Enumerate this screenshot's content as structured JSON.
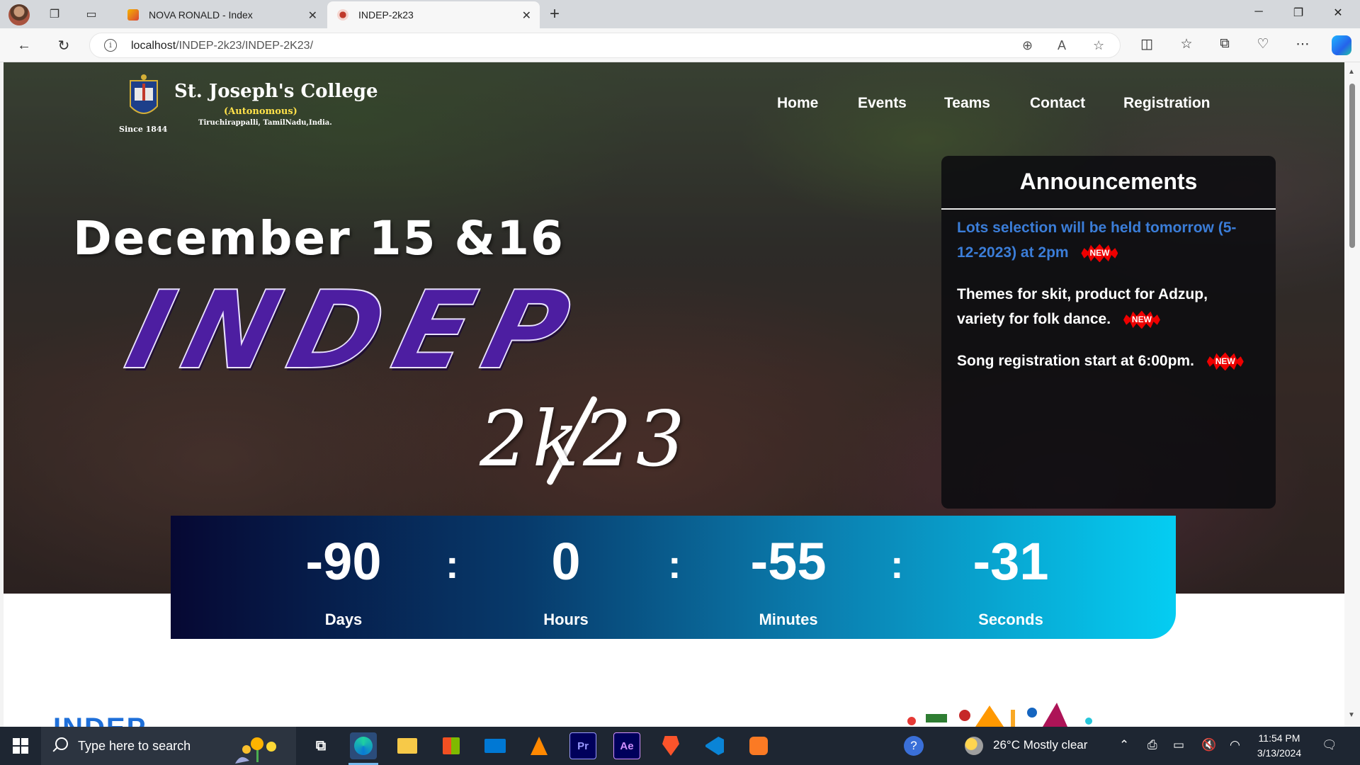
{
  "browser": {
    "tabs": [
      {
        "title": "NOVA RONALD - Index"
      },
      {
        "title": "INDEP-2k23"
      }
    ],
    "url": {
      "host": "localhost",
      "path": "/INDEP-2k23/INDEP-2K23/"
    }
  },
  "site": {
    "logo": {
      "name": "St. Joseph's College",
      "subtitle": "(Autonomous)",
      "place": "Tiruchirappalli, TamilNadu,India.",
      "since": "Since 1844"
    },
    "nav": [
      {
        "label": "Home"
      },
      {
        "label": "Events"
      },
      {
        "label": "Teams"
      },
      {
        "label": "Contact"
      },
      {
        "label": "Registration"
      }
    ],
    "hero": {
      "date": "December 15 &16",
      "event": "INDEP",
      "year": "2k23"
    },
    "announcements": {
      "title": "Announcements",
      "items": [
        {
          "text": "Lots selection will be held tomorrow (5-12-2023) at 2pm",
          "badge": "NEW",
          "color": "#3b7dd8"
        },
        {
          "text": "Themes for skit, product for Adzup, variety for folk dance.",
          "badge": "NEW",
          "color": "#ffffff"
        },
        {
          "text": "Song registration start at 6:00pm.",
          "badge": "NEW",
          "color": "#ffffff"
        }
      ]
    },
    "countdown": {
      "days": "-90",
      "hours": "0",
      "minutes": "-55",
      "seconds": "-31",
      "labels": {
        "days": "Days",
        "hours": "Hours",
        "minutes": "Minutes",
        "seconds": "Seconds"
      },
      "separator": ":"
    },
    "below_peek": {
      "text": "INDEP"
    }
  },
  "taskbar": {
    "search_placeholder": "Type here to search",
    "weather": "26°C  Mostly clear",
    "time": "11:54 PM",
    "date": "3/13/2024",
    "apps": [
      "task-view-icon",
      "edge-icon",
      "file-explorer-icon",
      "store-icon",
      "mail-icon",
      "vlc-icon",
      "premiere-icon",
      "after-effects-icon",
      "brave-icon",
      "vscode-icon",
      "xampp-icon"
    ]
  },
  "colors": {
    "accent_purple": "#4d1ea1",
    "countdown_start": "#060833",
    "countdown_end": "#05cdf2",
    "announcement_link": "#3b7dd8",
    "badge_red": "#e00000"
  }
}
